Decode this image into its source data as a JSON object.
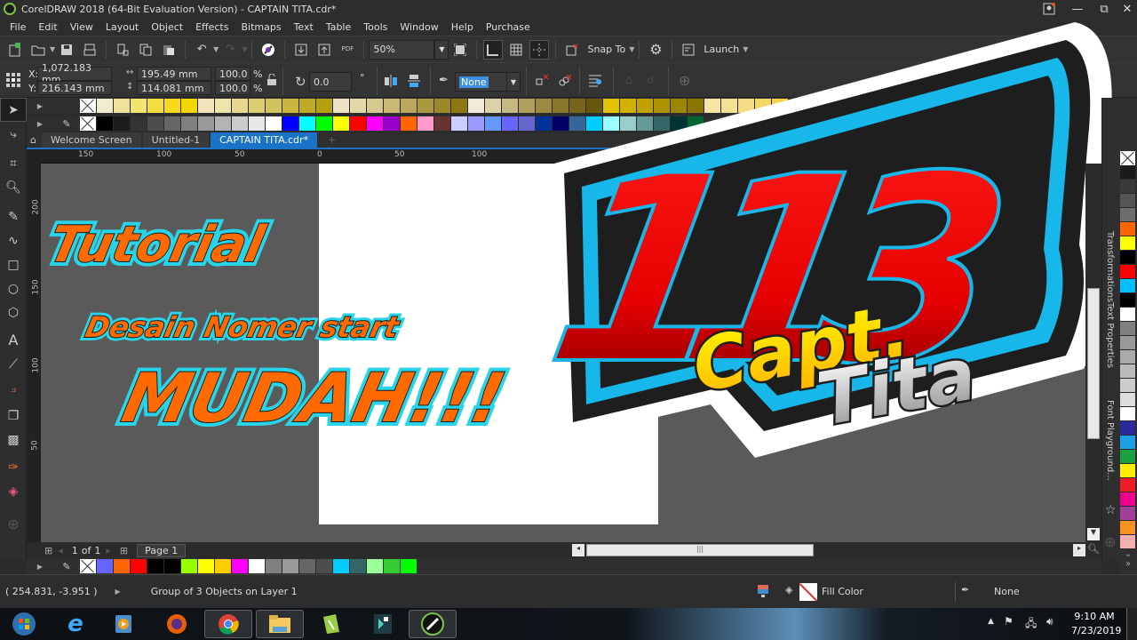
{
  "window": {
    "title": "CorelDRAW 2018 (64-Bit Evaluation Version) - CAPTAIN TITA.cdr*",
    "controls": {
      "minimize": "—",
      "restore": "⧉",
      "close": "✕"
    }
  },
  "menu": [
    "File",
    "Edit",
    "View",
    "Layout",
    "Object",
    "Effects",
    "Bitmaps",
    "Text",
    "Table",
    "Tools",
    "Window",
    "Help",
    "Purchase"
  ],
  "standard_toolbar": {
    "zoom_level": "50%",
    "snap_to": "Snap To",
    "launch": "Launch",
    "pdf_label": "PDF"
  },
  "property_bar": {
    "x_label": "X:",
    "x_value": "1,072.183 mm",
    "y_label": "Y:",
    "y_value": "216.143 mm",
    "width_value": "195.49 mm",
    "height_value": "114.081 mm",
    "scale_x": "100.0",
    "scale_y": "100.0",
    "percent": "%",
    "rotation": "0.0",
    "degree": "°",
    "outline": "None"
  },
  "doc_tabs": [
    {
      "label": "Welcome Screen",
      "active": false
    },
    {
      "label": "Untitled-1",
      "active": false
    },
    {
      "label": "CAPTAIN TITA.cdr*",
      "active": true
    }
  ],
  "rulers": {
    "horizontal": [
      "150",
      "100",
      "50",
      "0",
      "50",
      "100"
    ],
    "vertical": [
      "200",
      "150",
      "100",
      "50"
    ]
  },
  "artwork": {
    "left_text": [
      "Tutorial",
      "Desain Nomer start",
      "MUDAH!!!"
    ],
    "number": "113",
    "name_line1": "Capt.",
    "name_line2": "Tita"
  },
  "page_nav": {
    "current": "1",
    "of": "of",
    "total": "1",
    "page_tab": "Page 1"
  },
  "palette_top_yellow": [
    "#f2eccf",
    "#efe39a",
    "#f3e36f",
    "#f4de44",
    "#f7d919",
    "#f4d700",
    "#f2e4b8",
    "#ece4a9",
    "#e6d98f",
    "#dccf73",
    "#d3c35c",
    "#c9b63f",
    "#c0ab25",
    "#b5a012",
    "#ece3c6",
    "#e3d8a8",
    "#d6c98f",
    "#c8b975",
    "#baa85c",
    "#ab9843",
    "#9c882a",
    "#8c7715",
    "#f2ead8",
    "#dcd1aa",
    "#c6b883",
    "#b0a05f",
    "#9c8a43",
    "#89772c",
    "#77651a",
    "#66560e",
    "#e3c300",
    "#d0b000",
    "#bfa200",
    "#ad9300",
    "#9c8500",
    "#8a7700",
    "#f6e5a6",
    "#f5e196",
    "#f4dd83",
    "#f4d866",
    "#f4d240"
  ],
  "palette_top_default": [
    "#000000",
    "#1c1c1c",
    "#333333",
    "#4d4d4d",
    "#666666",
    "#808080",
    "#999999",
    "#b3b3b3",
    "#cccccc",
    "#e6e6e6",
    "#ffffff",
    "#0000ff",
    "#00ffff",
    "#00ff00",
    "#ffff00",
    "#ff0000",
    "#ff00ff",
    "#9900cc",
    "#ff6600",
    "#ff99cc",
    "#663333",
    "#ccccff",
    "#9999ff",
    "#6699ff",
    "#6666ff",
    "#6666cc",
    "#003399",
    "#000066",
    "#336699",
    "#00ccff",
    "#99ffff",
    "#99cccc",
    "#669999",
    "#336666",
    "#003333",
    "#006633"
  ],
  "palette_bottom": [
    "#6666ff",
    "#ff6600",
    "#ff0000",
    "#000000",
    "#000000",
    "#99ff00",
    "#ffff00",
    "#ffcc00",
    "#ff00ff",
    "#ffffff",
    "#808080",
    "#999999",
    "#666666",
    "#4d4d4d",
    "#00ccff",
    "#336666",
    "#99ff99",
    "#33cc33",
    "#00ff00"
  ],
  "palette_right": [
    "#1a1a1a",
    "#3a3a3a",
    "#555555",
    "#6e6e6e",
    "#ff6600",
    "#ffff00",
    "#000000",
    "#ff0000",
    "#00bfff",
    "#000000",
    "#ffffff",
    "#808080",
    "#999999",
    "#aaaaaa",
    "#bbbbbb",
    "#cccccc",
    "#dddddd",
    "#ffffff",
    "#2a2a9a",
    "#1ea0e8",
    "#1aa040",
    "#ffee00",
    "#ee1c24",
    "#ec008c",
    "#a0409a",
    "#f7931e",
    "#f4b0b0"
  ],
  "dockers": [
    "Transformations",
    "Text Properties",
    "Font Playground..."
  ],
  "status": {
    "coords": "( 254.831, -3.951 )",
    "info": "Group of 3 Objects on Layer 1",
    "fill_label": "Fill Color",
    "outline_label": "None"
  },
  "taskbar": {
    "apps": [
      "Start",
      "Internet Explorer",
      "Media Player",
      "Firefox",
      "Chrome",
      "File Explorer",
      "CorelDRAW Graphics Suite",
      "Filmora",
      "CorelDRAW"
    ],
    "time": "9:10 AM",
    "date": "7/23/2019"
  },
  "colors": {
    "accent": "#1a73c7",
    "art_orange": "#ff6a00",
    "art_cyan": "#29d3e8",
    "logo_red": "#e60000",
    "logo_blue": "#18b7e9",
    "logo_yellow": "#ffea00"
  }
}
